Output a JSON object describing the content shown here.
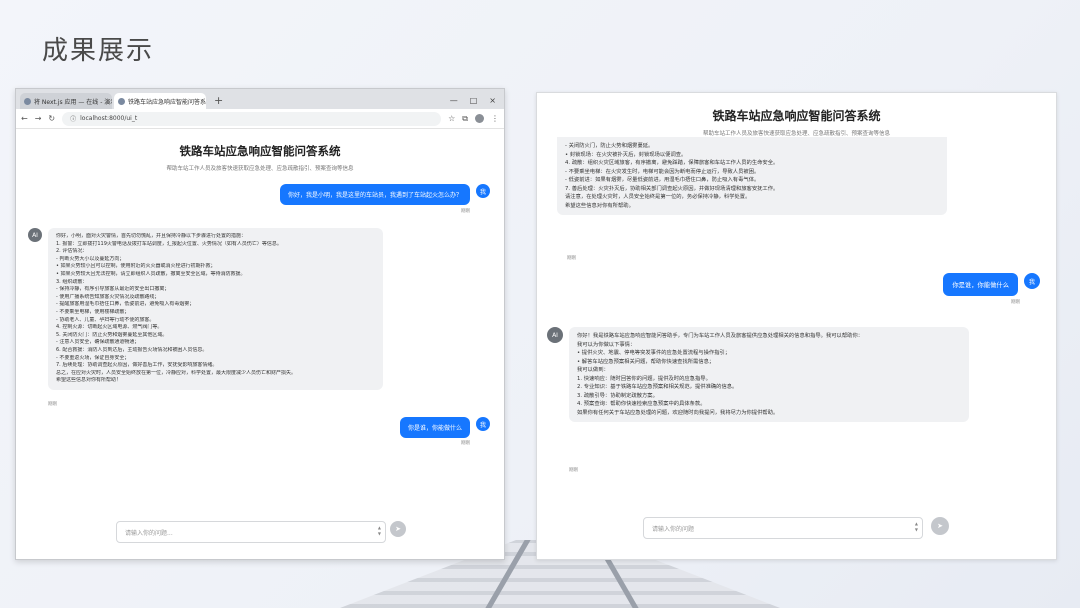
{
  "slide": {
    "title": "成果展示"
  },
  "browser": {
    "tabs": [
      {
        "label": "将 Next.js 应用 — 在线 - 演示地址",
        "close": "×"
      },
      {
        "label": "铁路车站应急响应智能问答系统",
        "close": "×"
      }
    ],
    "new_tab": "+",
    "window_controls": [
      "—",
      "□",
      "×"
    ],
    "url": "localhost:8000/ui_t"
  },
  "app": {
    "title": "铁路车站应急响应智能问答系统",
    "subtitle": "帮助车站工作人员及旅客快速获取应急处理、应急疏散指引、预案查询等信息"
  },
  "left_chat": {
    "user_msg_1": "你好，我是小明，我是这里的车站员，我遇到了车站起火怎么办？",
    "user_time_1": "刚刚",
    "ai_answer_lines": [
      "你好，小明，面对火灾警情，首先切勿慌乱，并且保持冷静以下步骤进行处置的措施：",
      "1. 报警：立即拨打119火警电话及拨打车站调度，汇报起火位置、火势情况（如有人员伤亡）等信息。",
      "2. 评估情况：",
      "  - 判断火势大小以及蔓延方向；",
      "• 如果火势较小且可以控制，使用附近的灭火器或消火栓进行初期扑救；",
      "• 如果火势较大且无法控制，请立即组织人员疏散，撤离至安全区域，等待消防救援。",
      "3. 组织疏散：",
      "  - 保持冷静，有序引导旅客从最近的安全出口撤离；",
      "  - 使用广播系统告知旅客火灾情况及疏散路线；",
      "  - 提醒旅客用湿毛巾捂住口鼻，低姿前进，避免吸入有毒烟雾；",
      "  - 不要乘坐电梯，使用楼梯疏散；",
      "  - 协助老人、儿童、孕妇等行动不便的旅客。",
      "4. 控制火源：切断起火区域电源、燃气阀门等。",
      "5. 关闭防火门：防止火势和烟雾蔓延至其他区域。",
      "  - 注意人员安全，确保疏散通道畅通；",
      "6. 配合救援：消防人员到达后，主动报告火场情况和被困人员信息。",
      "  - 不要重返火场，保证自身安全；",
      "7. 后续处理：协助调查起火原因，做好善后工作，安抚受影响旅客情绪。",
      "总之，在应对火灾时，人员安全始终放在第一位，冷静应对，科学处置，最大限度减少人员伤亡和财产损失。",
      "希望这些信息对你有所帮助！"
    ],
    "ai_time": "刚刚",
    "user_msg_2": "你是谁，你能做什么",
    "user_time_2": "刚刚"
  },
  "right_chat": {
    "ai_answer_tail": [
      "  - 关闭防火门，防止火势和烟雾蔓延。",
      "• 封锁现场：在火灾被扑灭后，封锁现场以便调查。",
      "4. 疏散：组织火灾区域旅客，有序撤离，避免踩踏，保障旅客和车站工作人员的生命安全。",
      "  - 不要乘坐电梯：在火灾发生时，电梯可能会因为断电而停止运行，导致人员被困。",
      "  - 低姿前进：如果有烟雾，尽量低姿前进，用湿毛巾捂住口鼻，防止吸入有毒气体。",
      "7. 善后处理：火灾扑灭后，协助相关部门调查起火原因，并做好现场清理和旅客安抚工作。",
      "  请注意，在处理火灾时，人员安全始终是第一位的，务必保持冷静，科学处置。",
      "  希望这些信息对你有所帮助。"
    ],
    "ai_time_1": "刚刚",
    "user_msg": "你是谁，你能做什么",
    "user_time": "刚刚",
    "ai_answer_2_lines": [
      "你好！我是铁路车站应急响应智能问答助手，专门为车站工作人员及旅客提供应急处理相关的信息和指导。我可以帮助你：",
      "我可以为你做以下事情：",
      "• 提供火灾、地震、停电等突发事件的应急处置流程与操作指引；",
      "• 解答车站应急预案相关问题，帮助你快速查找所需信息；",
      "我可以做到：",
      "1. 快速响应：随时回答你的问题，提供及时的应急指导。",
      "2. 专业知识：基于铁路车站应急预案和相关规范，提供准确的信息。",
      "3. 疏散引导：协助制定疏散方案。",
      "4. 预案查询：帮助你快速检索应急预案中的具体条款。",
      "  如果你有任何关于车站应急处理的问题，欢迎随时向我提问，我将尽力为你提供帮助。"
    ],
    "ai_time_2": "刚刚"
  },
  "composer": {
    "placeholder_left": "请输入你的问题...",
    "placeholder_right": "请输入你的问题",
    "send_icon": "➤",
    "spin_up": "▲",
    "spin_down": "▼"
  },
  "avatars": {
    "me": "我",
    "ai": "AI"
  }
}
